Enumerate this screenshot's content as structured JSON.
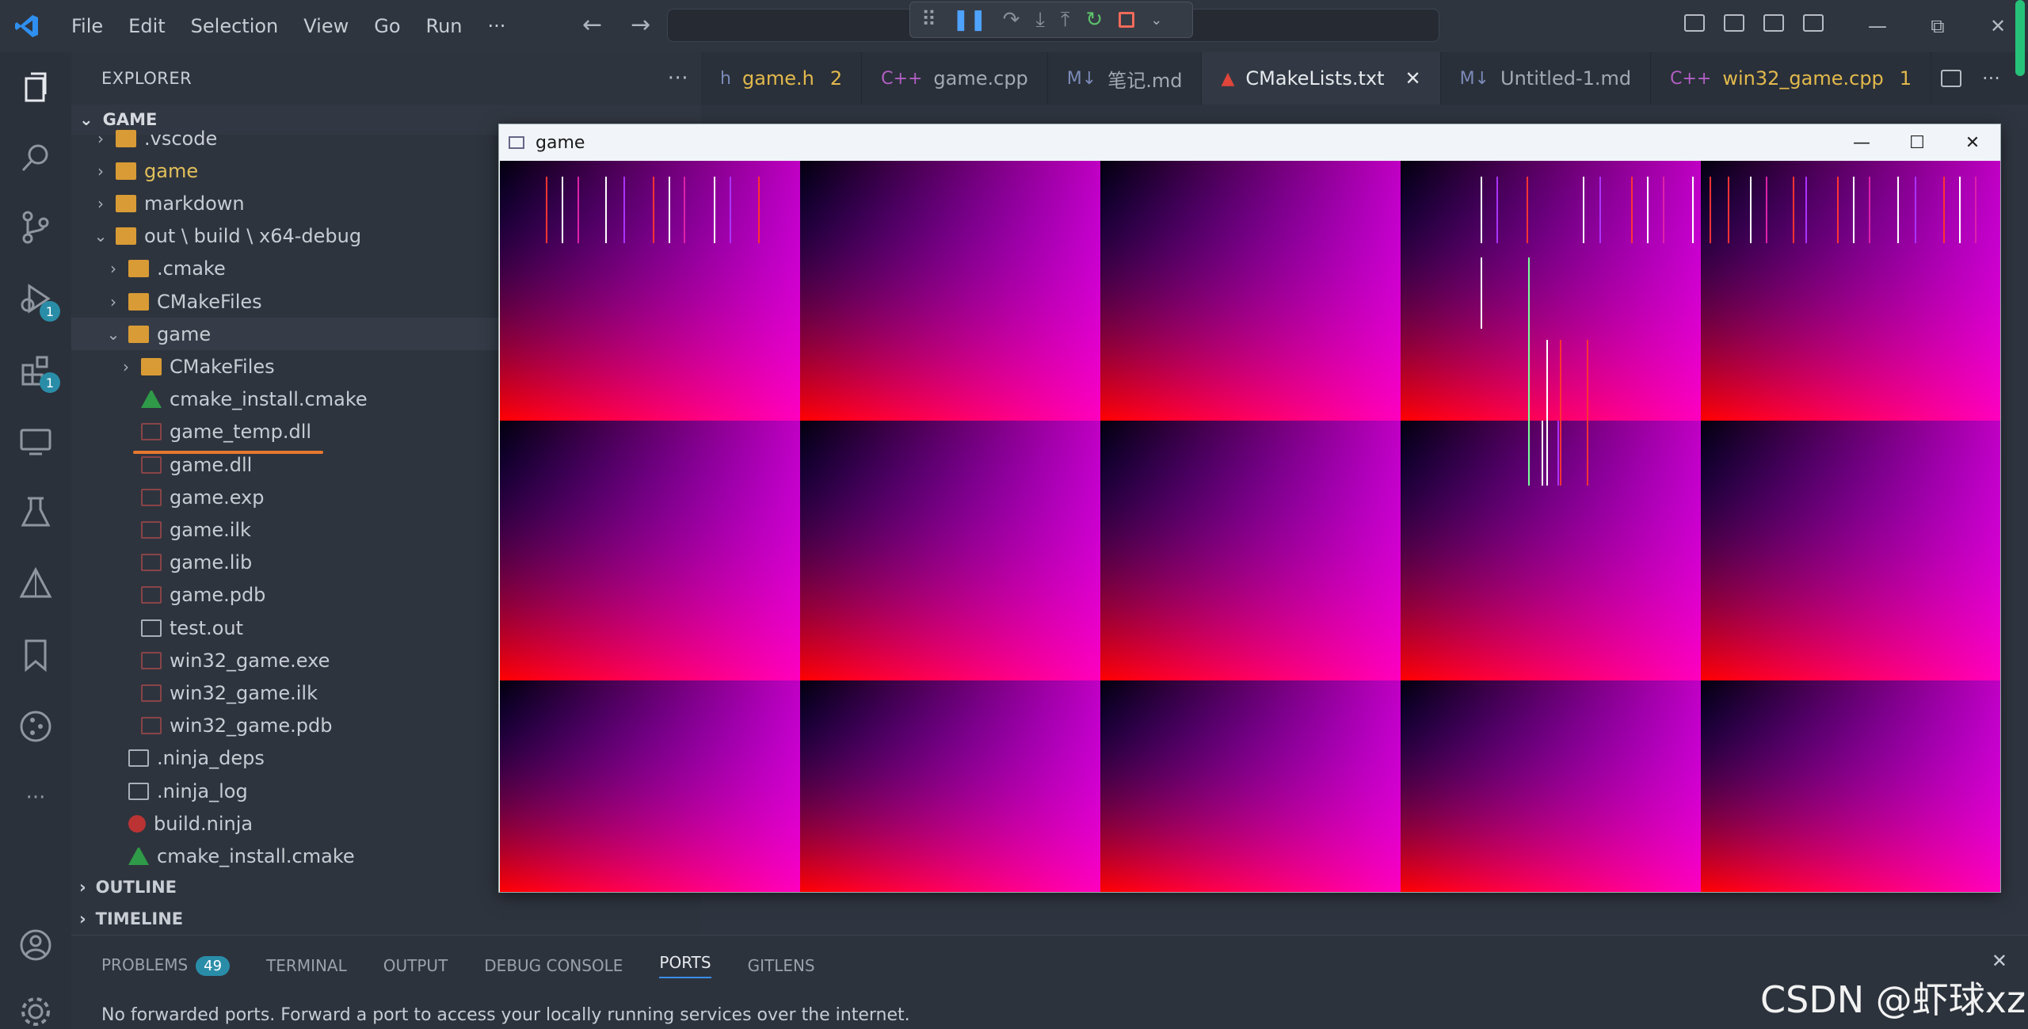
{
  "titlebar": {
    "menu": [
      "File",
      "Edit",
      "Selection",
      "View",
      "Go",
      "Run",
      "···"
    ],
    "nav_back": "←",
    "nav_forward": "→",
    "window_controls": [
      "—",
      "⧉",
      "✕"
    ]
  },
  "debug_toolbar": {
    "icons": [
      "grip-icon",
      "pause-icon",
      "step-over-icon",
      "step-into-icon",
      "step-out-icon",
      "restart-icon",
      "stop-icon"
    ]
  },
  "activity": {
    "run_badge": "1",
    "extensions_badge": "1"
  },
  "sidebar": {
    "title": "EXPLORER",
    "more": "···",
    "root": "GAME",
    "items": [
      {
        "label": ".vscode",
        "indent": 1,
        "chev": "›",
        "icon": "folder"
      },
      {
        "label": "game",
        "indent": 1,
        "chev": "›",
        "icon": "folder",
        "highlight": true
      },
      {
        "label": "markdown",
        "indent": 1,
        "chev": "›",
        "icon": "folder"
      },
      {
        "label": "out \\ build \\ x64-debug",
        "indent": 1,
        "chev": "⌄",
        "icon": "folder-open"
      },
      {
        "label": ".cmake",
        "indent": 2,
        "chev": "›",
        "icon": "folder"
      },
      {
        "label": "CMakeFiles",
        "indent": 2,
        "chev": "›",
        "icon": "folder"
      },
      {
        "label": "game",
        "indent": 2,
        "chev": "⌄",
        "icon": "folder-open",
        "selected": true
      },
      {
        "label": "CMakeFiles",
        "indent": 3,
        "chev": "›",
        "icon": "folder"
      },
      {
        "label": "cmake_install.cmake",
        "indent": 3,
        "chev": "",
        "icon": "cmake"
      },
      {
        "label": "game_temp.dll",
        "indent": 3,
        "chev": "",
        "icon": "binary"
      },
      {
        "label": "game.dll",
        "indent": 3,
        "chev": "",
        "icon": "binary"
      },
      {
        "label": "game.exp",
        "indent": 3,
        "chev": "",
        "icon": "binary"
      },
      {
        "label": "game.ilk",
        "indent": 3,
        "chev": "",
        "icon": "binary"
      },
      {
        "label": "game.lib",
        "indent": 3,
        "chev": "",
        "icon": "binary"
      },
      {
        "label": "game.pdb",
        "indent": 3,
        "chev": "",
        "icon": "binary"
      },
      {
        "label": "test.out",
        "indent": 3,
        "chev": "",
        "icon": "file"
      },
      {
        "label": "win32_game.exe",
        "indent": 3,
        "chev": "",
        "icon": "binary"
      },
      {
        "label": "win32_game.ilk",
        "indent": 3,
        "chev": "",
        "icon": "binary"
      },
      {
        "label": "win32_game.pdb",
        "indent": 3,
        "chev": "",
        "icon": "binary"
      },
      {
        "label": ".ninja_deps",
        "indent": 2,
        "chev": "",
        "icon": "file"
      },
      {
        "label": ".ninja_log",
        "indent": 2,
        "chev": "",
        "icon": "file"
      },
      {
        "label": "build.ninja",
        "indent": 2,
        "chev": "",
        "icon": "ninja"
      },
      {
        "label": "cmake_install.cmake",
        "indent": 2,
        "chev": "",
        "icon": "cmake"
      }
    ],
    "outline": "OUTLINE",
    "timeline": "TIMELINE"
  },
  "tabs": [
    {
      "icon": "h",
      "label": "game.h",
      "num": "2",
      "warn": true
    },
    {
      "icon": "C++",
      "label": "game.cpp",
      "num": ""
    },
    {
      "icon": "M↓",
      "label": "笔记.md",
      "num": ""
    },
    {
      "icon": "▲",
      "label": "CMakeLists.txt",
      "num": "",
      "active": true,
      "close": "✕"
    },
    {
      "icon": "M↓",
      "label": "Untitled-1.md",
      "num": ""
    },
    {
      "icon": "C++",
      "label": "win32_game.cpp",
      "num": "1",
      "warn": true
    }
  ],
  "panel": {
    "tabs": [
      "PROBLEMS",
      "TERMINAL",
      "OUTPUT",
      "DEBUG CONSOLE",
      "PORTS",
      "GITLENS"
    ],
    "problems_count": "49",
    "active_tab": "PORTS",
    "message": "No forwarded ports. Forward a port to access your locally running services over the internet.",
    "close": "✕"
  },
  "game_window": {
    "title": "game",
    "controls": [
      "—",
      "☐",
      "✕"
    ]
  },
  "watermark": "CSDN @虾球xz",
  "colors": {
    "accent": "#3b8eea",
    "badge": "#2a8da8",
    "underline": "#e7782e"
  }
}
